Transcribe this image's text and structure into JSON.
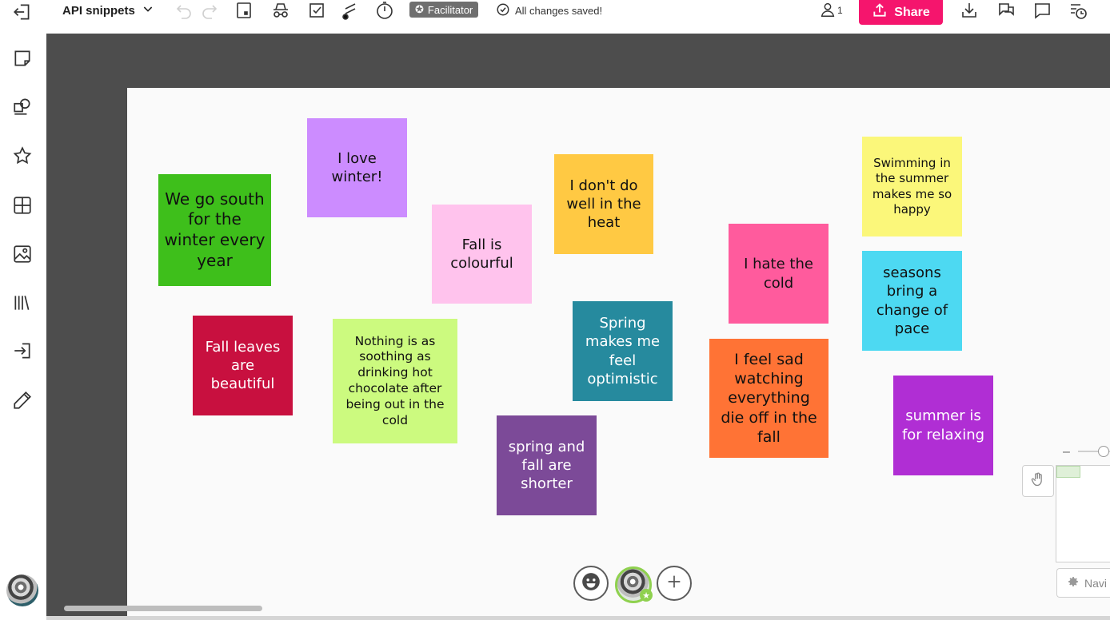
{
  "toolbar": {
    "board_title": "API snippets",
    "facilitator_label": "Facilitator",
    "save_status": "All changes saved!",
    "user_count": "1",
    "share_label": "Share"
  },
  "sidebar": {
    "items": [
      {
        "icon": "exit-board-icon"
      },
      {
        "icon": "sticky-note-icon"
      },
      {
        "icon": "shapes-icon"
      },
      {
        "icon": "star-icon"
      },
      {
        "icon": "frame-grid-icon"
      },
      {
        "icon": "image-icon"
      },
      {
        "icon": "library-icon"
      },
      {
        "icon": "import-icon"
      },
      {
        "icon": "pen-icon"
      }
    ]
  },
  "notes": [
    {
      "text": "We go south for the winter every year",
      "color": "#3ebf1b"
    },
    {
      "text": "I love winter!",
      "color": "#cc8cff"
    },
    {
      "text": "Fall is colourful",
      "color": "#ffc3ed"
    },
    {
      "text": "I don't do well in the heat",
      "color": "#ffc943"
    },
    {
      "text": "Swimming in the summer makes me so happy",
      "color": "#fbf77a"
    },
    {
      "text": "I hate the cold",
      "color": "#ff5b9d"
    },
    {
      "text": "seasons bring a change of pace",
      "color": "#4dd9f2"
    },
    {
      "text": "Fall leaves are beautiful",
      "color": "#c8103f"
    },
    {
      "text": "Nothing is as soothing as drinking hot chocolate after being out in the cold",
      "color": "#ccfa7f"
    },
    {
      "text": "Spring makes me feel optimistic",
      "color": "#268a9e"
    },
    {
      "text": "I feel sad watching everything die off in the fall",
      "color": "#ff7335"
    },
    {
      "text": "summer is for relaxing",
      "color": "#b02ed4"
    },
    {
      "text": "spring and fall are shorter",
      "color": "#7c4a98"
    }
  ],
  "bottom": {
    "navigator_label": "Navi"
  }
}
